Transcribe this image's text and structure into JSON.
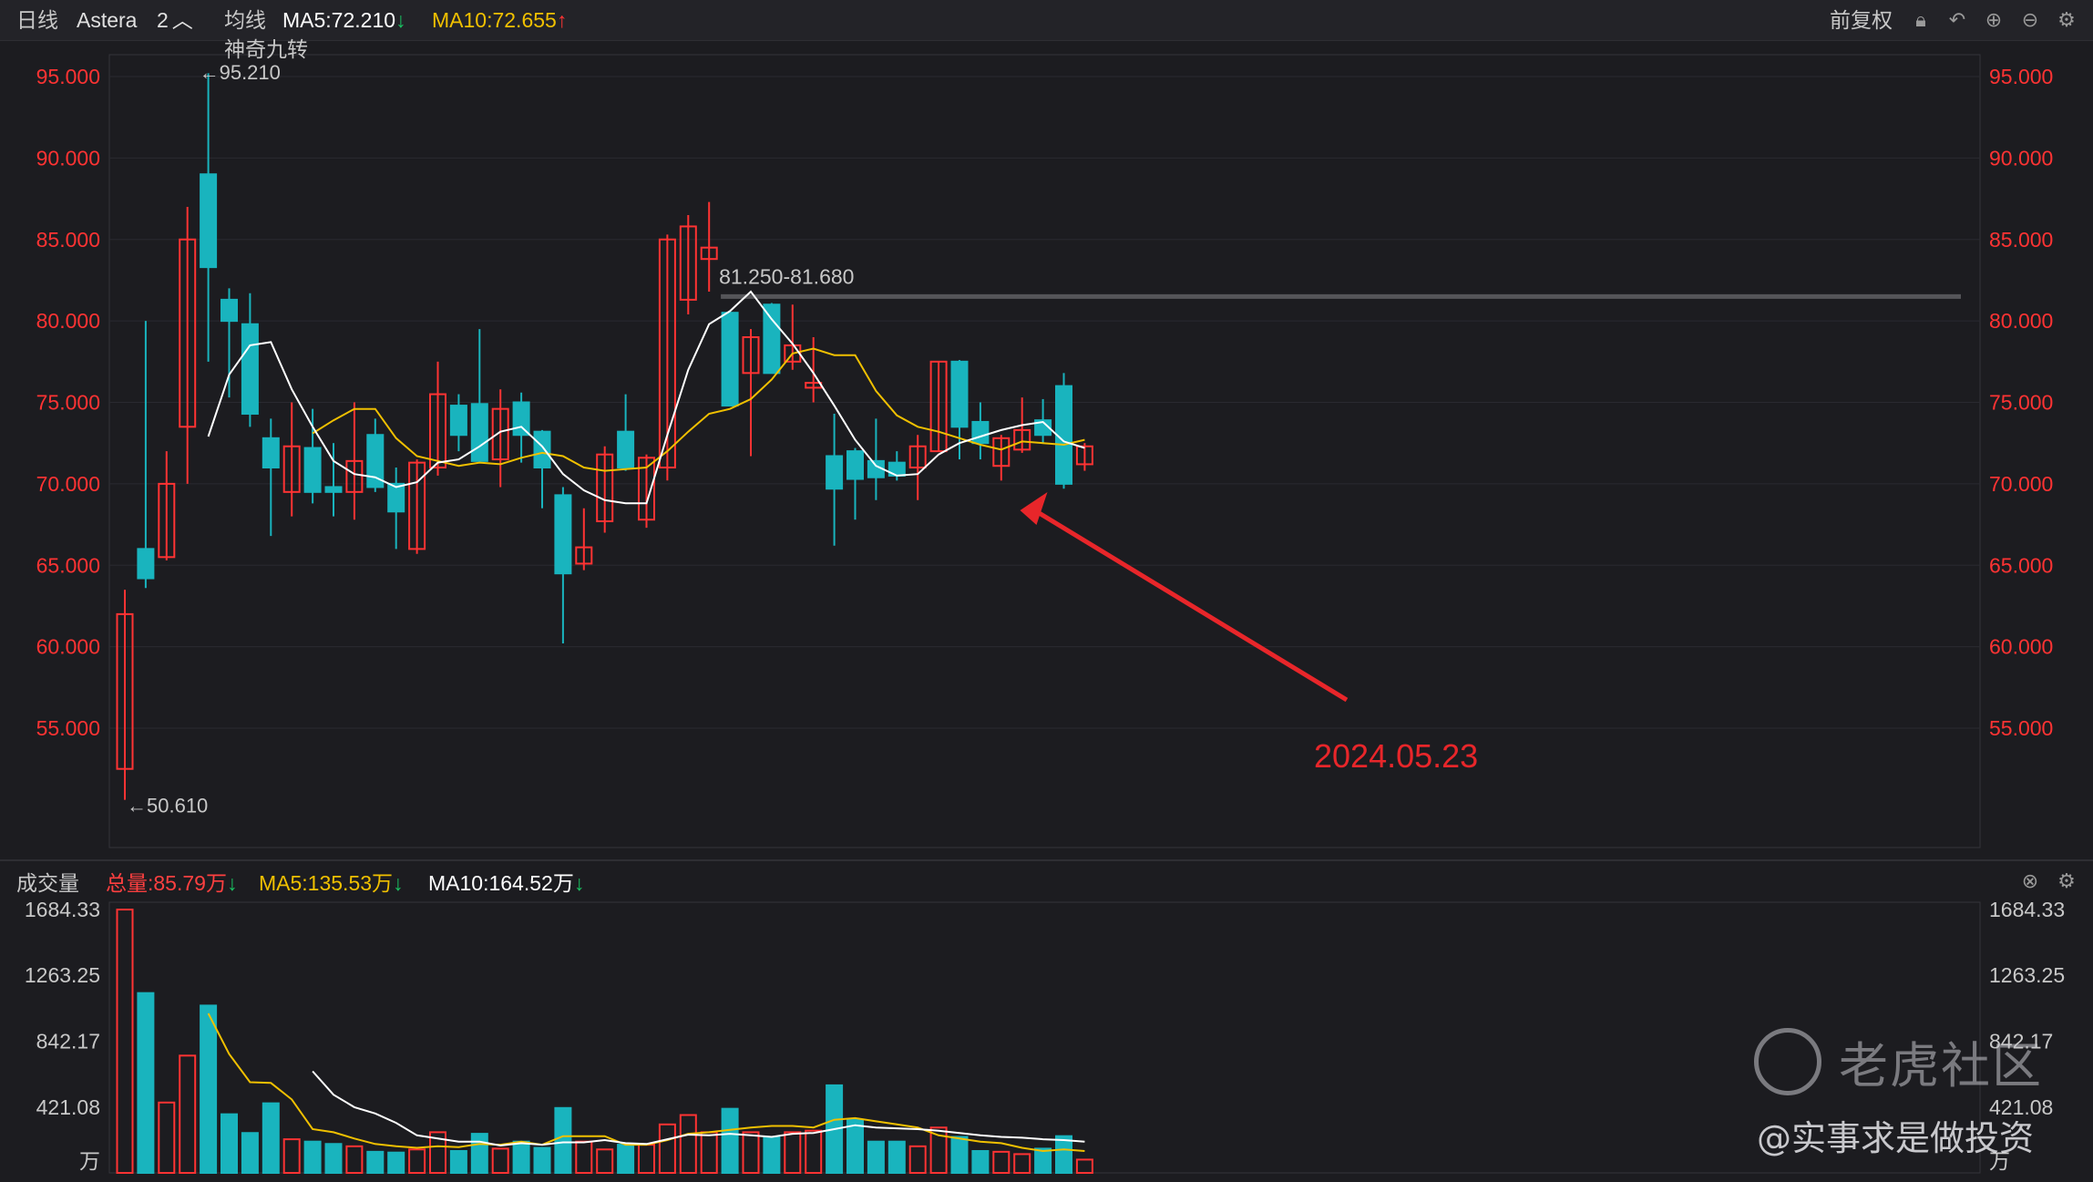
{
  "header": {
    "period": "日线",
    "symbol": "Astera",
    "count": "2",
    "ma_title": "均线",
    "ma5": "MA5:72.210",
    "ma10": "MA10:72.655",
    "indicator": "神奇九转",
    "adjust": "前复权"
  },
  "volume_header": {
    "title": "成交量",
    "total": "总量:85.79万",
    "ma5": "MA5:135.53万",
    "ma10": "MA10:164.52万"
  },
  "colors": {
    "up": "#ff3333",
    "down": "#19b4be",
    "ma5": "#ffffff",
    "ma10": "#f0c000",
    "price_axis": "#ff3333",
    "annotation": "#e8262a"
  },
  "watermark": {
    "brand": "老虎社区",
    "author": "@实事求是做投资"
  },
  "chart_data": {
    "type": "candlestick",
    "price_axis": {
      "ylim": [
        50.61,
        95.21
      ],
      "ticks": [
        "95.000",
        "90.000",
        "85.000",
        "80.000",
        "75.000",
        "70.000",
        "65.000",
        "60.000",
        "55.000"
      ],
      "tick_values": [
        95,
        90,
        85,
        80,
        75,
        70,
        65,
        60,
        55
      ]
    },
    "candles": [
      {
        "o": 52.5,
        "h": 63.5,
        "l": 50.6,
        "c": 62.0
      },
      {
        "o": 66.0,
        "h": 80.0,
        "l": 63.6,
        "c": 64.2
      },
      {
        "o": 65.5,
        "h": 72.0,
        "l": 65.3,
        "c": 70.0
      },
      {
        "o": 73.5,
        "h": 87.0,
        "l": 70.0,
        "c": 85.0
      },
      {
        "o": 89.0,
        "h": 95.2,
        "l": 77.5,
        "c": 83.3
      },
      {
        "o": 81.3,
        "h": 82.0,
        "l": 75.3,
        "c": 80.0
      },
      {
        "o": 79.8,
        "h": 81.7,
        "l": 73.5,
        "c": 74.3
      },
      {
        "o": 72.8,
        "h": 74.0,
        "l": 66.8,
        "c": 71.0
      },
      {
        "o": 69.5,
        "h": 75.0,
        "l": 68.0,
        "c": 72.3
      },
      {
        "o": 72.2,
        "h": 74.6,
        "l": 68.8,
        "c": 69.5
      },
      {
        "o": 69.8,
        "h": 72.5,
        "l": 68.0,
        "c": 69.5
      },
      {
        "o": 69.5,
        "h": 75.0,
        "l": 67.8,
        "c": 71.4
      },
      {
        "o": 73.0,
        "h": 74.0,
        "l": 69.5,
        "c": 69.8
      },
      {
        "o": 70.0,
        "h": 71.0,
        "l": 66.0,
        "c": 68.3
      },
      {
        "o": 66.0,
        "h": 71.5,
        "l": 65.7,
        "c": 71.3
      },
      {
        "o": 71.0,
        "h": 77.5,
        "l": 70.5,
        "c": 75.5
      },
      {
        "o": 74.8,
        "h": 75.5,
        "l": 72.0,
        "c": 73.0
      },
      {
        "o": 74.9,
        "h": 79.5,
        "l": 71.3,
        "c": 71.4
      },
      {
        "o": 71.5,
        "h": 75.8,
        "l": 69.8,
        "c": 74.6
      },
      {
        "o": 75.0,
        "h": 75.6,
        "l": 71.3,
        "c": 73.0
      },
      {
        "o": 73.2,
        "h": 73.3,
        "l": 68.5,
        "c": 71.0
      },
      {
        "o": 69.3,
        "h": 69.8,
        "l": 60.2,
        "c": 64.5
      },
      {
        "o": 65.1,
        "h": 68.5,
        "l": 64.7,
        "c": 66.1
      },
      {
        "o": 67.7,
        "h": 72.3,
        "l": 67.0,
        "c": 71.8
      },
      {
        "o": 73.2,
        "h": 75.5,
        "l": 70.8,
        "c": 71.0
      },
      {
        "o": 67.8,
        "h": 71.8,
        "l": 67.3,
        "c": 71.6
      },
      {
        "o": 71.0,
        "h": 85.3,
        "l": 70.2,
        "c": 85.0
      },
      {
        "o": 81.3,
        "h": 86.5,
        "l": 80.4,
        "c": 85.8
      },
      {
        "o": 83.8,
        "h": 87.3,
        "l": 81.8,
        "c": 84.5
      },
      {
        "o": 80.5,
        "h": 80.5,
        "l": 74.8,
        "c": 74.8
      },
      {
        "o": 76.8,
        "h": 79.5,
        "l": 71.7,
        "c": 79.0
      },
      {
        "o": 81.0,
        "h": 81.1,
        "l": 76.8,
        "c": 76.8
      },
      {
        "o": 77.5,
        "h": 81.0,
        "l": 77.0,
        "c": 78.5
      },
      {
        "o": 75.9,
        "h": 79.0,
        "l": 75.0,
        "c": 76.2
      },
      {
        "o": 71.7,
        "h": 74.3,
        "l": 66.2,
        "c": 69.7
      },
      {
        "o": 72.0,
        "h": 72.2,
        "l": 67.8,
        "c": 70.3
      },
      {
        "o": 71.4,
        "h": 74.0,
        "l": 69.0,
        "c": 70.4
      },
      {
        "o": 71.3,
        "h": 72.0,
        "l": 70.2,
        "c": 70.5
      },
      {
        "o": 71.0,
        "h": 73.0,
        "l": 69.0,
        "c": 72.3
      },
      {
        "o": 72.0,
        "h": 77.5,
        "l": 72.0,
        "c": 77.5
      },
      {
        "o": 77.5,
        "h": 77.6,
        "l": 71.5,
        "c": 73.5
      },
      {
        "o": 73.8,
        "h": 75.0,
        "l": 71.5,
        "c": 72.5
      },
      {
        "o": 71.1,
        "h": 73.0,
        "l": 70.2,
        "c": 72.8
      },
      {
        "o": 72.1,
        "h": 75.3,
        "l": 71.9,
        "c": 73.3
      },
      {
        "o": 73.9,
        "h": 75.2,
        "l": 72.5,
        "c": 73.0
      },
      {
        "o": 76.0,
        "h": 76.8,
        "l": 69.7,
        "c": 70.0
      },
      {
        "o": 71.2,
        "h": 72.5,
        "l": 70.8,
        "c": 72.3
      }
    ],
    "ma5": [
      null,
      null,
      null,
      null,
      72.9,
      76.7,
      78.5,
      78.7,
      75.8,
      73.5,
      71.4,
      70.6,
      70.4,
      69.8,
      70.1,
      71.3,
      71.5,
      72.3,
      73.2,
      73.5,
      72.3,
      70.6,
      69.6,
      69.0,
      68.8,
      68.8,
      73.0,
      77.0,
      79.8,
      80.6,
      81.8,
      80.1,
      78.6,
      76.8,
      74.8,
      72.7,
      71.1,
      70.5,
      70.6,
      71.8,
      72.5,
      72.9,
      73.3,
      73.6,
      73.8,
      72.6,
      72.2
    ],
    "ma10": [
      null,
      null,
      null,
      null,
      null,
      null,
      null,
      null,
      null,
      73.1,
      73.9,
      74.6,
      74.6,
      72.8,
      71.7,
      71.4,
      71.1,
      71.3,
      71.2,
      71.6,
      71.9,
      71.7,
      71.0,
      70.8,
      70.9,
      71.0,
      72.0,
      73.2,
      74.3,
      74.6,
      75.2,
      76.4,
      78.0,
      78.3,
      77.9,
      77.9,
      75.7,
      74.2,
      73.5,
      73.2,
      72.8,
      72.4,
      72.1,
      72.6,
      72.5,
      72.4,
      72.7
    ],
    "annotations": {
      "high_label": "95.210",
      "low_label": "50.610",
      "range_label": "81.250-81.680",
      "range_level": 81.5,
      "range_start_index": 29,
      "date_label": "2024.05.23",
      "date_index": 45
    },
    "volume": {
      "unit": "万",
      "ylim": [
        0,
        1684.33
      ],
      "ticks": [
        "1684.33",
        "1263.25",
        "842.17",
        "421.08"
      ],
      "tick_values": [
        1684.33,
        1263.25,
        842.17,
        421.08
      ],
      "values": [
        1684,
        1150,
        450,
        750,
        1070,
        375,
        255,
        445,
        215,
        200,
        185,
        170,
        135,
        130,
        150,
        260,
        140,
        250,
        155,
        200,
        160,
        415,
        200,
        150,
        180,
        180,
        310,
        370,
        260,
        410,
        260,
        230,
        260,
        270,
        560,
        340,
        200,
        200,
        170,
        290,
        230,
        140,
        135,
        120,
        155,
        235,
        85
      ],
      "ma5": [
        null,
        null,
        null,
        null,
        1020,
        760,
        580,
        575,
        470,
        280,
        260,
        220,
        185,
        170,
        160,
        170,
        165,
        185,
        180,
        200,
        180,
        235,
        235,
        235,
        180,
        180,
        210,
        250,
        260,
        275,
        290,
        300,
        300,
        290,
        340,
        350,
        330,
        310,
        290,
        240,
        220,
        200,
        190,
        160,
        140,
        150,
        140
      ],
      "ma10": [
        null,
        null,
        null,
        null,
        null,
        null,
        null,
        null,
        null,
        650,
        500,
        420,
        380,
        320,
        240,
        220,
        200,
        200,
        175,
        190,
        180,
        195,
        195,
        210,
        190,
        185,
        215,
        245,
        240,
        250,
        240,
        230,
        250,
        255,
        280,
        305,
        290,
        285,
        280,
        270,
        255,
        240,
        230,
        225,
        215,
        210,
        200
      ]
    }
  }
}
